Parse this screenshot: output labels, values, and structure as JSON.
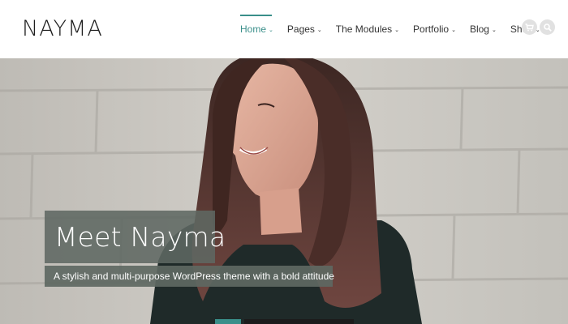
{
  "site": {
    "logo": "NAYMA"
  },
  "nav": {
    "items": [
      {
        "label": "Home",
        "active": true
      },
      {
        "label": "Pages",
        "active": false
      },
      {
        "label": "The Modules",
        "active": false
      },
      {
        "label": "Portfolio",
        "active": false
      },
      {
        "label": "Blog",
        "active": false
      },
      {
        "label": "Shop",
        "active": false
      }
    ],
    "chevron": "⌄",
    "icons": [
      "cart-icon",
      "search-icon"
    ]
  },
  "hero": {
    "title": "Meet Nayma",
    "subtitle": "A stylish and multi-purpose WordPress theme with a bold attitude"
  },
  "colors": {
    "accent": "#3a8f8a",
    "overlay": "#5e6862"
  }
}
